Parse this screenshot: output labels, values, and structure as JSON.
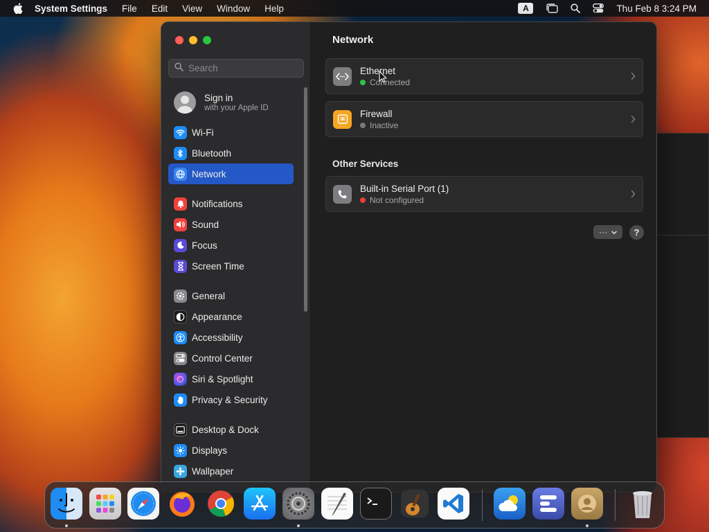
{
  "menubar": {
    "app_name": "System Settings",
    "menus": [
      "File",
      "Edit",
      "View",
      "Window",
      "Help"
    ],
    "input_source": "A",
    "clock": "Thu Feb 8  3:24 PM"
  },
  "sidebar": {
    "search_placeholder": "Search",
    "signin": {
      "title": "Sign in",
      "subtitle": "with your Apple ID"
    },
    "items": [
      {
        "label": "Wi-Fi",
        "icon": "wifi-icon",
        "color": "#1e8cf5"
      },
      {
        "label": "Bluetooth",
        "icon": "bluetooth-icon",
        "color": "#1e8cf5"
      },
      {
        "label": "Network",
        "icon": "globe-icon",
        "color": "#1e8cf5",
        "active": true
      },
      {
        "label": "Notifications",
        "icon": "bell-icon",
        "color": "#f0423c"
      },
      {
        "label": "Sound",
        "icon": "speaker-icon",
        "color": "#f0423c"
      },
      {
        "label": "Focus",
        "icon": "moon-icon",
        "color": "#5a4bd6"
      },
      {
        "label": "Screen Time",
        "icon": "hourglass-icon",
        "color": "#5a4bd6"
      },
      {
        "label": "General",
        "icon": "gear-icon",
        "color": "#8a8a8c"
      },
      {
        "label": "Appearance",
        "icon": "appearance-icon",
        "color": "#1a1a1a"
      },
      {
        "label": "Accessibility",
        "icon": "accessibility-icon",
        "color": "#1e8cf5"
      },
      {
        "label": "Control Center",
        "icon": "control-center-icon",
        "color": "#8a8a8c"
      },
      {
        "label": "Siri & Spotlight",
        "icon": "siri-icon",
        "color": "#6b3fd1"
      },
      {
        "label": "Privacy & Security",
        "icon": "hand-icon",
        "color": "#1e8cf5"
      },
      {
        "label": "Desktop & Dock",
        "icon": "dock-icon",
        "color": "#1a1a1a"
      },
      {
        "label": "Displays",
        "icon": "sun-icon",
        "color": "#1e8cf5"
      },
      {
        "label": "Wallpaper",
        "icon": "flower-icon",
        "color": "#3aa6e0"
      }
    ]
  },
  "content": {
    "title": "Network",
    "services": [
      {
        "name": "Ethernet",
        "status": "Connected",
        "status_color": "#30c24a",
        "icon": "ethernet-icon"
      },
      {
        "name": "Firewall",
        "status": "Inactive",
        "status_color": "#7a7a7a",
        "icon": "firewall-icon"
      }
    ],
    "other_title": "Other Services",
    "other_services": [
      {
        "name": "Built-in Serial Port (1)",
        "status": "Not configured",
        "status_color": "#e8403a",
        "icon": "phone-icon"
      }
    ],
    "more_label": "···",
    "help_label": "?"
  },
  "dock": {
    "apps": [
      "finder-icon",
      "launchpad-icon",
      "safari-icon",
      "firefox-icon",
      "chrome-icon",
      "app-store-icon",
      "system-settings-icon",
      "textedit-icon",
      "terminal-icon",
      "garageband-icon",
      "vscode-icon",
      "weather-icon",
      "app-icon",
      "contacts-icon",
      "trash-icon"
    ]
  }
}
